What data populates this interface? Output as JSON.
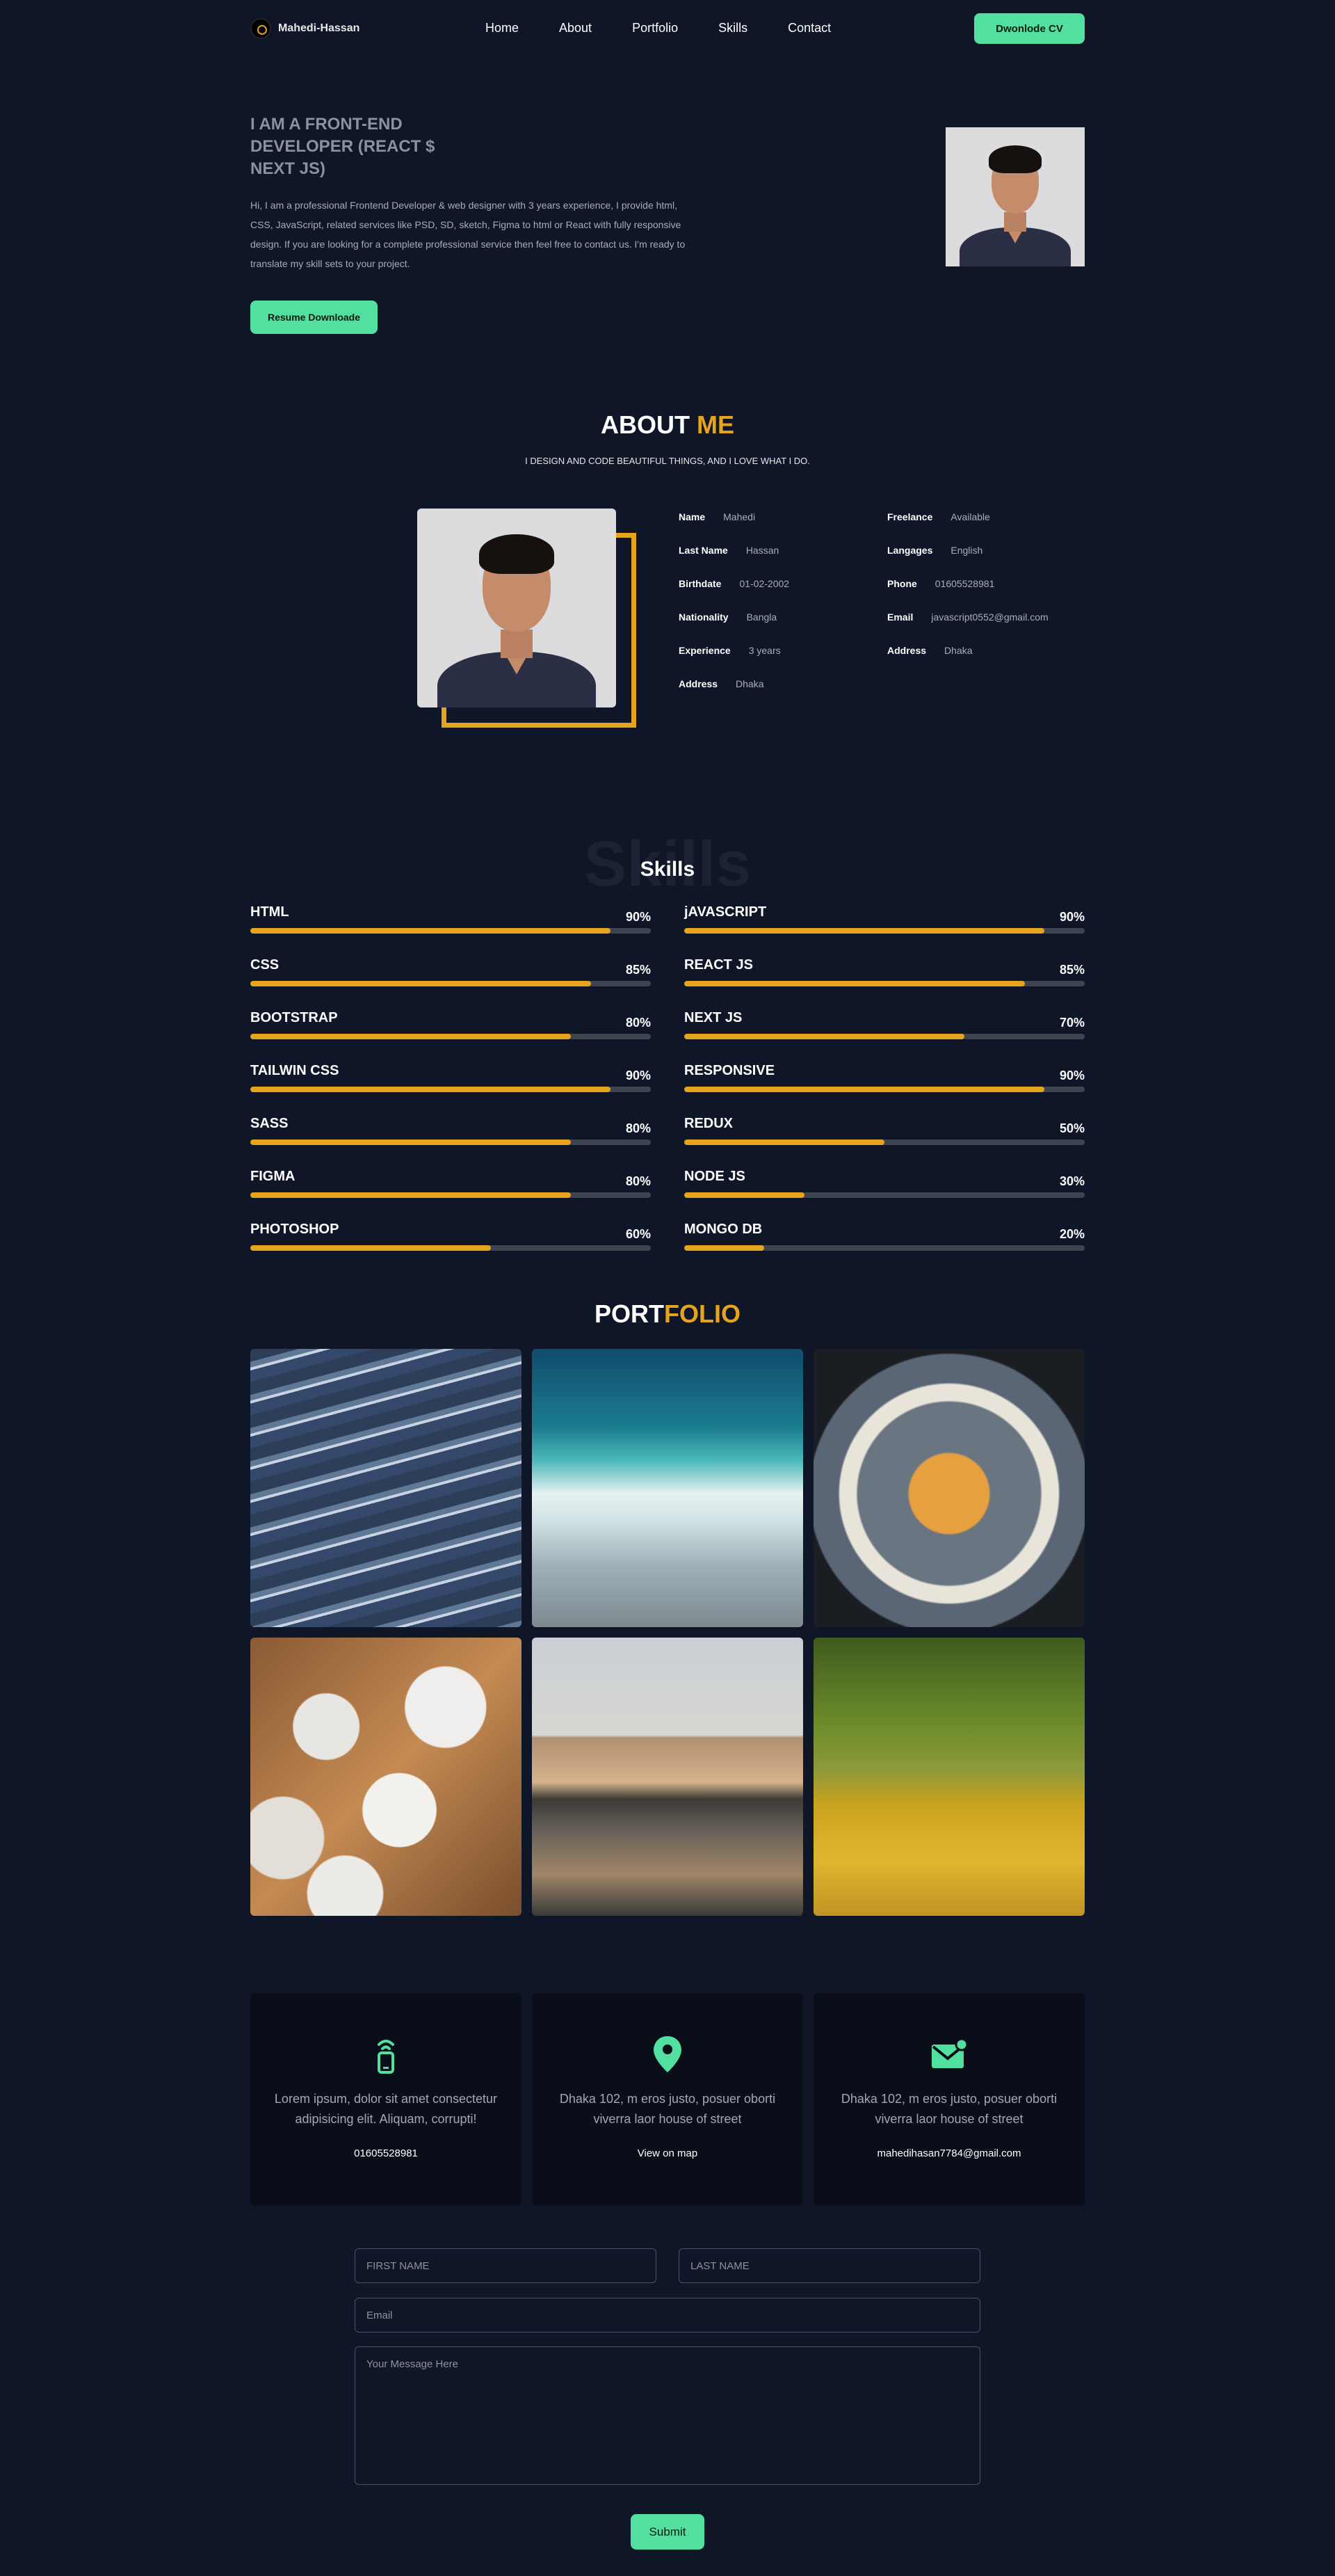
{
  "nav": {
    "brand": "Mahedi-Hassan",
    "links": [
      "Home",
      "About",
      "Portfolio",
      "Skills",
      "Contact"
    ],
    "cv_button": "Dwonlode CV"
  },
  "hero": {
    "title": "I AM A FRONT-END DEVELOPER (REACT $ NEXT JS)",
    "text": "Hi, I am a professional Frontend Developer & web designer with 3 years experience, I provide html, CSS, JavaScript, related services like PSD, SD, sketch, Figma to html or React with fully responsive design. If you are looking for a complete professional service then feel free to contact us. I'm ready to translate my skill sets to your project.",
    "button": "Resume Downloade"
  },
  "about": {
    "title_a": "ABOUT ",
    "title_b": "ME",
    "subtitle": "I DESIGN AND CODE BEAUTIFUL THINGS, AND I LOVE WHAT I DO.",
    "left": [
      {
        "k": "Name",
        "v": "Mahedi"
      },
      {
        "k": "Last Name",
        "v": "Hassan"
      },
      {
        "k": "Birthdate",
        "v": "01-02-2002"
      },
      {
        "k": "Nationality",
        "v": "Bangla"
      },
      {
        "k": "Experience",
        "v": "3 years"
      },
      {
        "k": "Address",
        "v": "Dhaka"
      }
    ],
    "right": [
      {
        "k": "Freelance",
        "v": "Available"
      },
      {
        "k": "Langages",
        "v": "English"
      },
      {
        "k": "Phone",
        "v": "01605528981"
      },
      {
        "k": "Email",
        "v": "javascript0552@gmail.com"
      },
      {
        "k": "Address",
        "v": "Dhaka"
      }
    ]
  },
  "skills": {
    "bg_text": "Skills",
    "title": "Skills",
    "left": [
      {
        "name": "HTML",
        "pct": "90%",
        "value": 90
      },
      {
        "name": "CSS",
        "pct": "85%",
        "value": 85
      },
      {
        "name": "BOOTSTRAP",
        "pct": "80%",
        "value": 80
      },
      {
        "name": "TAILWIN CSS",
        "pct": "90%",
        "value": 90
      },
      {
        "name": "SASS",
        "pct": "80%",
        "value": 80
      },
      {
        "name": "FIGMA",
        "pct": "80%",
        "value": 80
      },
      {
        "name": "PHOTOSHOP",
        "pct": "60%",
        "value": 60
      }
    ],
    "right": [
      {
        "name": "jAVASCRIPT",
        "pct": "90%",
        "value": 90
      },
      {
        "name": "REACT JS",
        "pct": "85%",
        "value": 85
      },
      {
        "name": "NEXT JS",
        "pct": "70%",
        "value": 70
      },
      {
        "name": "RESPONSIVE",
        "pct": "90%",
        "value": 90
      },
      {
        "name": "REDUX",
        "pct": "50%",
        "value": 50
      },
      {
        "name": "NODE JS",
        "pct": "30%",
        "value": 30
      },
      {
        "name": "MONGO DB",
        "pct": "20%",
        "value": 20
      }
    ]
  },
  "portfolio": {
    "title_a": "PORT",
    "title_b": "FOLIO"
  },
  "contact": {
    "cards": [
      {
        "icon": "phone-signal-icon",
        "desc": "Lorem ipsum, dolor sit amet consectetur adipisicing elit. Aliquam, corrupti!",
        "value": "01605528981"
      },
      {
        "icon": "map-pin-icon",
        "desc": "Dhaka 102, m eros justo, posuer oborti viverra laor house of street",
        "value": "View on map"
      },
      {
        "icon": "mail-icon",
        "desc": "Dhaka 102, m eros justo, posuer oborti viverra laor house of street",
        "value": "mahedihasan7784@gmail.com"
      }
    ],
    "form": {
      "first_name": "FIRST NAME",
      "last_name": "LAST NAME",
      "email": "Email",
      "message": "Your Message Here",
      "submit": "Submit"
    }
  },
  "colors": {
    "background": "#0f1627",
    "accent": "#e6a31c",
    "button": "#52e0a0"
  }
}
